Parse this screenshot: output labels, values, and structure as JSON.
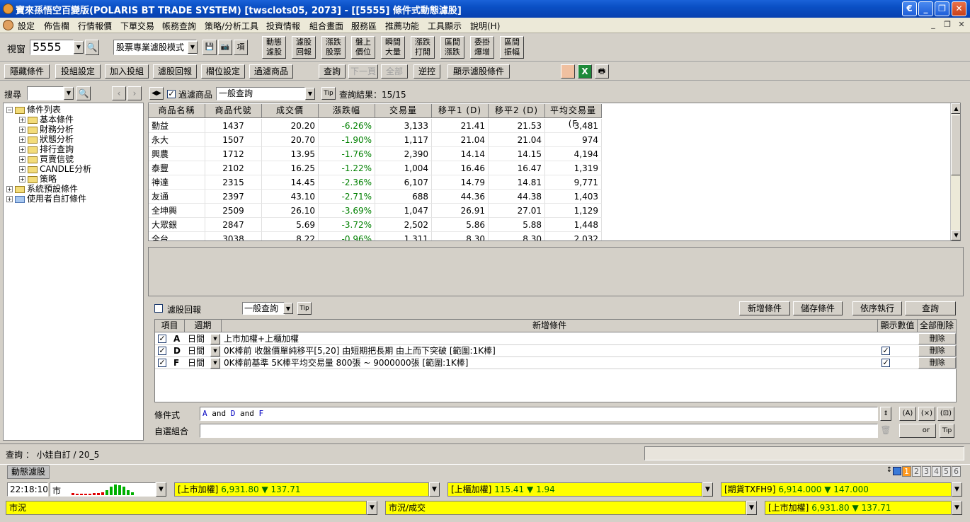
{
  "window": {
    "title": "寶來孫悟空百變版(POLARIS BT TRADE SYSTEM)   [twsclots05, 2073] - [[5555] 條件式動態濾股]",
    "controls": [
      "minimize",
      "restore",
      "close"
    ]
  },
  "menu": [
    "設定",
    "佈告欄",
    "行情報價",
    "下單交易",
    "帳務查詢",
    "策略/分析工具",
    "投資情報",
    "組合畫面",
    "服務區",
    "推薦功能",
    "工具顯示",
    "說明(H)"
  ],
  "toolbar": {
    "window_label": "視窗",
    "window_code": "5555",
    "mode_select": "股票專業濾股模式",
    "func_buttons": [
      {
        "l1": "動態",
        "l2": "濾股"
      },
      {
        "l1": "濾股",
        "l2": "回報"
      },
      {
        "l1": "漲跌",
        "l2": "股票"
      },
      {
        "l1": "盤上",
        "l2": "價位"
      },
      {
        "l1": "瞬間",
        "l2": "大量"
      },
      {
        "l1": "漲跌",
        "l2": "打開"
      },
      {
        "l1": "區間",
        "l2": "漲跌"
      },
      {
        "l1": "委掛",
        "l2": "爆增"
      },
      {
        "l1": "區間",
        "l2": "振幅"
      }
    ]
  },
  "toolbar2": {
    "buttons": [
      "隱藏條件",
      "投組設定",
      "加入投組",
      "濾股回報",
      "欄位設定",
      "過濾商品"
    ],
    "query": "查詢",
    "next_page": "下一頁",
    "all": "全部",
    "reverse": "逆控",
    "show_conditions": "顯示濾股條件"
  },
  "left": {
    "search_label": "搜尋",
    "tree": [
      {
        "label": "條件列表",
        "level": 0,
        "open": true,
        "folder": "open"
      },
      {
        "label": "基本條件",
        "level": 1
      },
      {
        "label": "財務分析",
        "level": 1
      },
      {
        "label": "狀態分析",
        "level": 1
      },
      {
        "label": "排行查詢",
        "level": 1
      },
      {
        "label": "買賣信號",
        "level": 1
      },
      {
        "label": "CANDLE分析",
        "level": 1
      },
      {
        "label": "策略",
        "level": 1
      },
      {
        "label": "系統預設條件",
        "level": 0
      },
      {
        "label": "使用者自訂條件",
        "level": 0,
        "blue": true
      }
    ]
  },
  "results": {
    "filter_label": "過濾商品",
    "query_type": "一般查詢",
    "tip": "Tip",
    "result_text": "查詢結果：15/15",
    "columns": [
      "商品名稱",
      "商品代號",
      "成交價",
      "漲跌幅",
      "交易量",
      "移平1 (D)",
      "移平2 (D)",
      "平均交易量 (F"
    ],
    "rows": [
      [
        "勤益",
        "1437",
        "20.20",
        "-6.26%",
        "3,133",
        "21.41",
        "21.53",
        "3,481"
      ],
      [
        "永大",
        "1507",
        "20.70",
        "-1.90%",
        "1,117",
        "21.04",
        "21.04",
        "974"
      ],
      [
        "興農",
        "1712",
        "13.95",
        "-1.76%",
        "2,390",
        "14.14",
        "14.15",
        "4,194"
      ],
      [
        "泰豐",
        "2102",
        "16.25",
        "-1.22%",
        "1,004",
        "16.46",
        "16.47",
        "1,319"
      ],
      [
        "神達",
        "2315",
        "14.45",
        "-2.36%",
        "6,107",
        "14.79",
        "14.81",
        "9,771"
      ],
      [
        "友通",
        "2397",
        "43.10",
        "-2.71%",
        "688",
        "44.36",
        "44.38",
        "1,403"
      ],
      [
        "全坤興",
        "2509",
        "26.10",
        "-3.69%",
        "1,047",
        "26.91",
        "27.01",
        "1,129"
      ],
      [
        "大眾銀",
        "2847",
        "5.69",
        "-3.72%",
        "2,502",
        "5.86",
        "5.88",
        "1,448"
      ],
      [
        "全台",
        "3038",
        "8.22",
        "-0.96%",
        "1,311",
        "8.30",
        "8.30",
        "2,032"
      ]
    ]
  },
  "conditions": {
    "report_label": "濾股回報",
    "query_type": "一般查詢",
    "tip": "Tip",
    "buttons": [
      "新增條件",
      "儲存條件",
      "依序執行",
      "查詢"
    ],
    "columns": [
      "項目",
      "週期",
      "新增條件",
      "顯示數值",
      "全部刪除"
    ],
    "rows": [
      {
        "item": "A",
        "period": "日間",
        "desc": "上市加權+上櫃加權",
        "show": false,
        "del": "刪除"
      },
      {
        "item": "D",
        "period": "日間",
        "desc": "0K棒前 收盤價單純移平[5,20] 由短期把長期 由上而下突破 [範圍:1K棒]",
        "show": true,
        "del": "刪除"
      },
      {
        "item": "F",
        "period": "日間",
        "desc": "0K棒前基準 5K棒平均交易量 800張 ~ 9000000張 [範圍:1K棒]",
        "show": true,
        "del": "刪除"
      }
    ],
    "formula_label": "條件式",
    "formula": {
      "p1": "A",
      "and1": " and ",
      "p2": "D",
      "and2": " and ",
      "p3": "F"
    },
    "combo_label": "自選組合",
    "or_label": "or",
    "tip2": "Tip"
  },
  "status": {
    "query_text": "查詢 ： 小娃自訂 / 20_5",
    "tab": "動態濾股",
    "page_tabs": [
      "1",
      "2",
      "3",
      "4",
      "5",
      "6"
    ],
    "time": "22:18:10",
    "market": "市",
    "tickers": [
      {
        "name": "[上市加權]",
        "value": "6,931.80",
        "arrow": "▼",
        "chg": "137.71"
      },
      {
        "name": "[上櫃加權]",
        "value": "115.41",
        "arrow": "▼",
        "chg": "1.94"
      },
      {
        "name": "[期貨TXFH9]",
        "value": "6,914.000",
        "arrow": "▼",
        "chg": "147.000"
      }
    ],
    "bottom": [
      "市況",
      "市況/成交"
    ],
    "bottom_ticker": {
      "name": "[上市加權]",
      "value": "6,931.80",
      "arrow": "▼",
      "chg": "137.71"
    }
  },
  "colors": {
    "title": "#0a4fc4",
    "up": "#008000",
    "highlight": "#ffff00"
  }
}
